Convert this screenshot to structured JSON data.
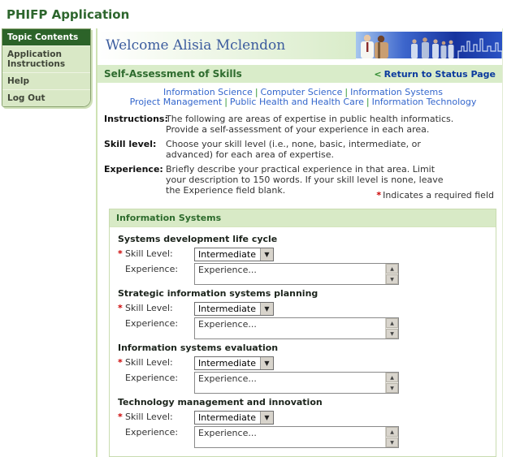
{
  "app": {
    "title": "PHIFP Application"
  },
  "sidebar": {
    "header": "Topic Contents",
    "items": [
      {
        "label": "Application Instructions"
      },
      {
        "label": "Help"
      },
      {
        "label": "Log Out"
      }
    ]
  },
  "header": {
    "welcome": "Welcome Alisia Mclendon"
  },
  "page": {
    "title": "Self-Assessment of Skills",
    "return_link": {
      "arrow": "<",
      "label": "Return to Status Page"
    },
    "nav_row1": [
      "Information Science",
      "Computer Science",
      "Information Systems"
    ],
    "nav_row2": [
      "Project Management",
      "Public Health and Health Care",
      "Information Technology"
    ],
    "instructions": [
      {
        "label": "Instructions:",
        "text": "The following are areas of expertise in public health informatics. Provide a self-assessment of your experience in each area."
      },
      {
        "label": "Skill level:",
        "text": "Choose your skill level (i.e., none, basic, intermediate, or advanced) for each area of expertise."
      },
      {
        "label": "Experience:",
        "text": "Briefly describe your practical experience in that area. Limit your description to 150 words. If your skill level is none, leave the Experience field blank."
      }
    ],
    "required_note": {
      "asterisk": "*",
      "text": "Indicates a required field"
    }
  },
  "section": {
    "title": "Information Systems",
    "skill_label": "Skill Level:",
    "experience_label": "Experience:",
    "required_mark": "*",
    "groups": [
      {
        "title": "Systems development life cycle",
        "skill_value": "Intermediate",
        "experience_value": "Experience..."
      },
      {
        "title": "Strategic information systems planning",
        "skill_value": "Intermediate",
        "experience_value": "Experience..."
      },
      {
        "title": "Information systems evaluation",
        "skill_value": "Intermediate",
        "experience_value": "Experience..."
      },
      {
        "title": "Technology management and innovation",
        "skill_value": "Intermediate",
        "experience_value": "Experience..."
      }
    ]
  },
  "icons": {
    "dropdown_arrow": "▼",
    "scroll_up": "▲",
    "scroll_down": "▼",
    "nav_separator": "|"
  },
  "colors": {
    "brand_green": "#2d662d",
    "panel_green": "#d9ecc9",
    "menu_header_green": "#2c6329",
    "link_blue": "#3366cc",
    "return_link_blue": "#0a3a9e",
    "welcome_blue": "#3c5c9e",
    "required_red": "#cc0000"
  }
}
